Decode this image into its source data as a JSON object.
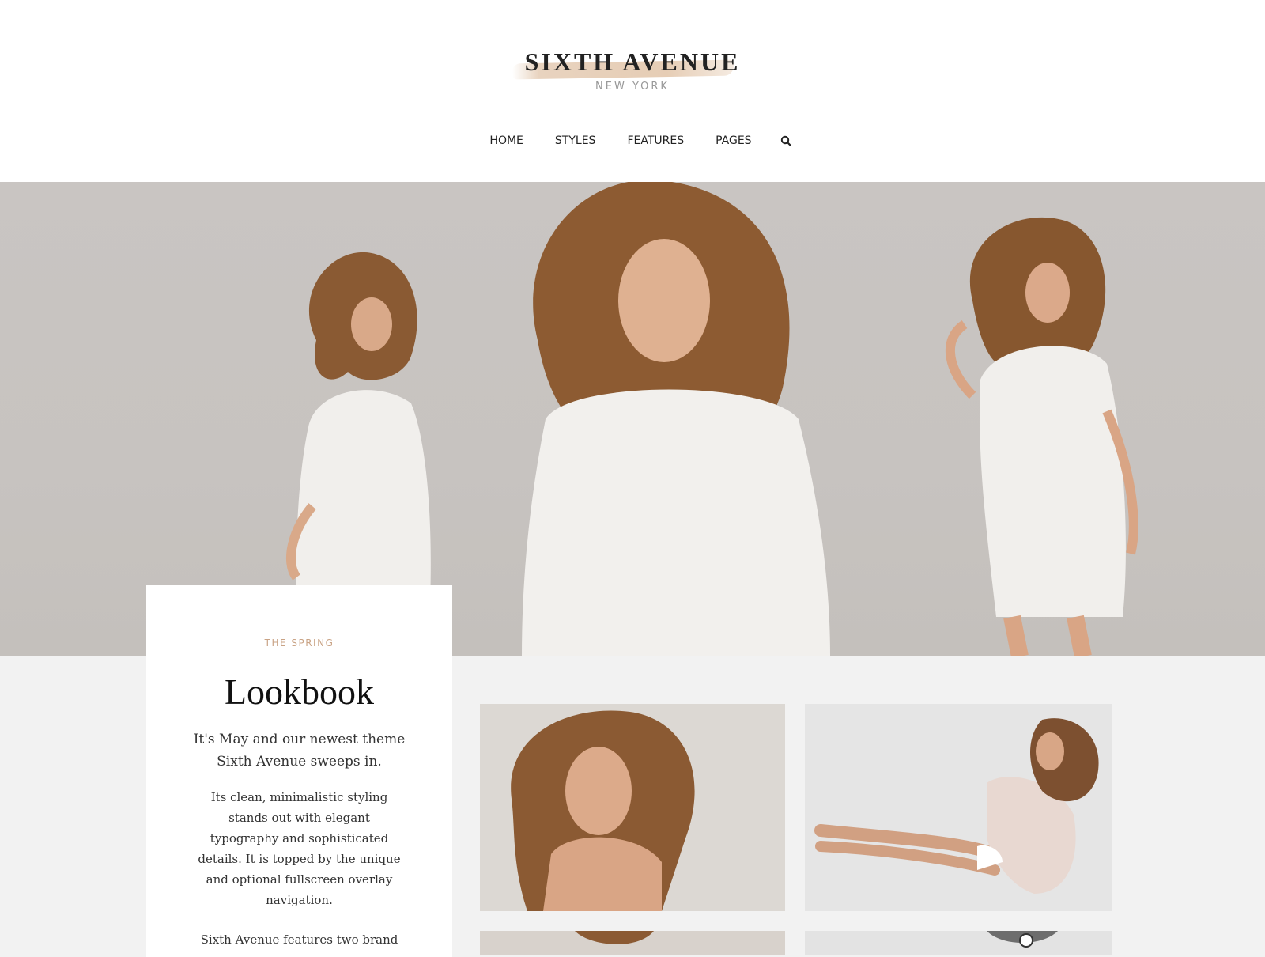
{
  "brand": {
    "title": "SIXTH AVENUE",
    "subtitle": "NEW YORK"
  },
  "nav": {
    "items": [
      "HOME",
      "STYLES",
      "FEATURES",
      "PAGES"
    ],
    "search_icon": "search-icon"
  },
  "card": {
    "eyebrow": "THE SPRING",
    "title": "Lookbook",
    "lead": "It's May and our newest theme Sixth Avenue sweeps in.",
    "body": "Its clean, minimalistic styling stands out with elegant typography and sophisticated details. It is topped by the unique and optional fullscreen overlay navigation.",
    "body2": "Sixth Avenue features two brand"
  },
  "colors": {
    "accent": "#c9a385",
    "hero_bg": "#c8c4c1",
    "page_bg": "#f2f2f2"
  }
}
